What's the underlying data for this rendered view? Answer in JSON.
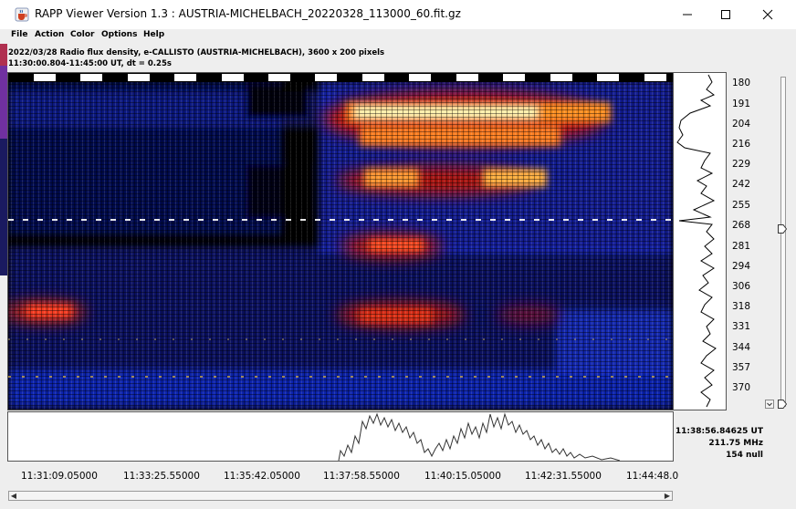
{
  "window": {
    "title": "RAPP Viewer Version 1.3 : AUSTRIA-MICHELBACH_20220328_113000_60.fit.gz",
    "minimize_label": "—",
    "maximize_label": "☐",
    "close_label": "✕"
  },
  "menu": {
    "items": [
      {
        "label": "File"
      },
      {
        "label": "Action"
      },
      {
        "label": "Color"
      },
      {
        "label": "Options"
      },
      {
        "label": "Help"
      }
    ]
  },
  "header": {
    "line1": "2022/03/28  Radio flux density, e-CALLISTO (AUSTRIA-MICHELBACH),  3600 x 200 pixels",
    "line2": "11:30:00.804-11:45:00 UT,  dt = 0.25s"
  },
  "spectrogram": {
    "freq_labels": [
      "180",
      "191",
      "204",
      "216",
      "229",
      "242",
      "255",
      "268",
      "281",
      "294",
      "306",
      "318",
      "331",
      "344",
      "357",
      "370"
    ],
    "time_labels": [
      "11:31:09.05000",
      "11:33:25.55000",
      "11:35:42.05000",
      "11:37:58.55000",
      "11:40:15.05000",
      "11:42:31.55000",
      "11:44:48.0"
    ],
    "colors": {
      "background": "#000000",
      "low": "#0a0a8c",
      "mid": "#2233ff",
      "hot": "#d02010",
      "peak": "#ffd040",
      "white": "#ffffff"
    }
  },
  "readout": {
    "time": "11:38:56.84625 UT",
    "frequency": "211.75 MHz",
    "value": "154 null"
  },
  "icons": {
    "app": "java-cup-icon",
    "scroll_left": "arrow-left-icon",
    "scroll_right": "arrow-right-icon",
    "slider_top": "slider-knob-icon",
    "slider_bottom": "slider-knob-icon"
  }
}
